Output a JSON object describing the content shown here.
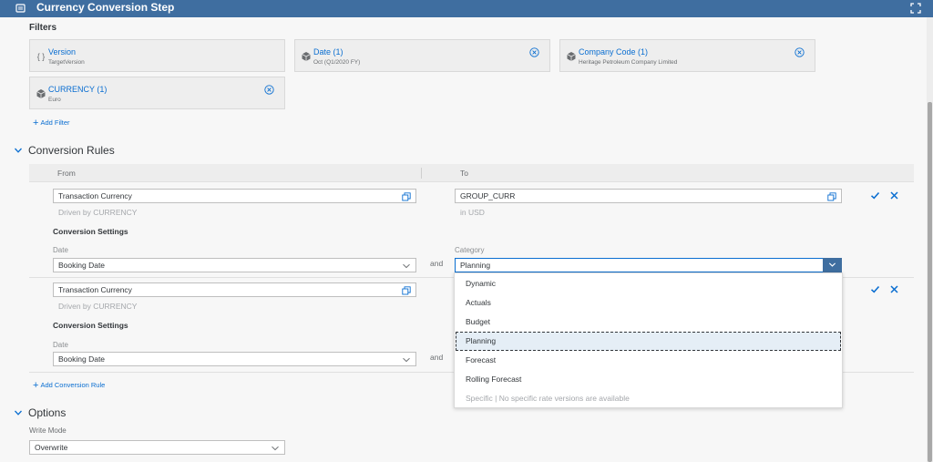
{
  "window": {
    "title": "Currency Conversion Step"
  },
  "filters": {
    "label": "Filters",
    "items": [
      {
        "name": "Version",
        "value": "TargetVersion",
        "icon": "curly-braces-icon",
        "removable": false
      },
      {
        "name": "Date (1)",
        "value": "Oct (Q1/2020 FY)",
        "icon": "dimension-icon",
        "removable": true
      },
      {
        "name": "Company Code (1)",
        "value": "Heritage Petroleum Company Limited",
        "icon": "dimension-icon",
        "removable": true
      },
      {
        "name": "CURRENCY (1)",
        "value": "Euro",
        "icon": "dimension-icon",
        "removable": true
      }
    ],
    "add_filter": "Add Filter"
  },
  "conversion_rules": {
    "heading": "Conversion Rules",
    "columns": {
      "from": "From",
      "to": "To"
    },
    "rules": [
      {
        "from_value": "Transaction Currency",
        "from_sub": "Driven by CURRENCY",
        "to_value": "GROUP_CURR",
        "to_sub": "in USD",
        "settings_label": "Conversion Settings",
        "date_label": "Date",
        "date_value": "Booking Date",
        "and_label": "and",
        "category_label": "Category",
        "category_value": "Planning"
      },
      {
        "from_value": "Transaction Currency",
        "from_sub": "Driven by CURRENCY",
        "settings_label": "Conversion Settings",
        "date_label": "Date",
        "date_value": "Booking Date",
        "and_label": "and"
      }
    ],
    "add_rule": "Add Conversion Rule"
  },
  "category_dropdown": {
    "options": [
      "Dynamic",
      "Actuals",
      "Budget",
      "Planning",
      "Forecast",
      "Rolling Forecast",
      "Specific | No specific rate versions are available"
    ],
    "selected": "Planning"
  },
  "options": {
    "heading": "Options",
    "write_mode_label": "Write Mode",
    "write_mode_value": "Overwrite"
  },
  "colors": {
    "header": "#3f6ea0",
    "accent": "#0a6ed1",
    "selected_bg": "#e5eef6"
  }
}
